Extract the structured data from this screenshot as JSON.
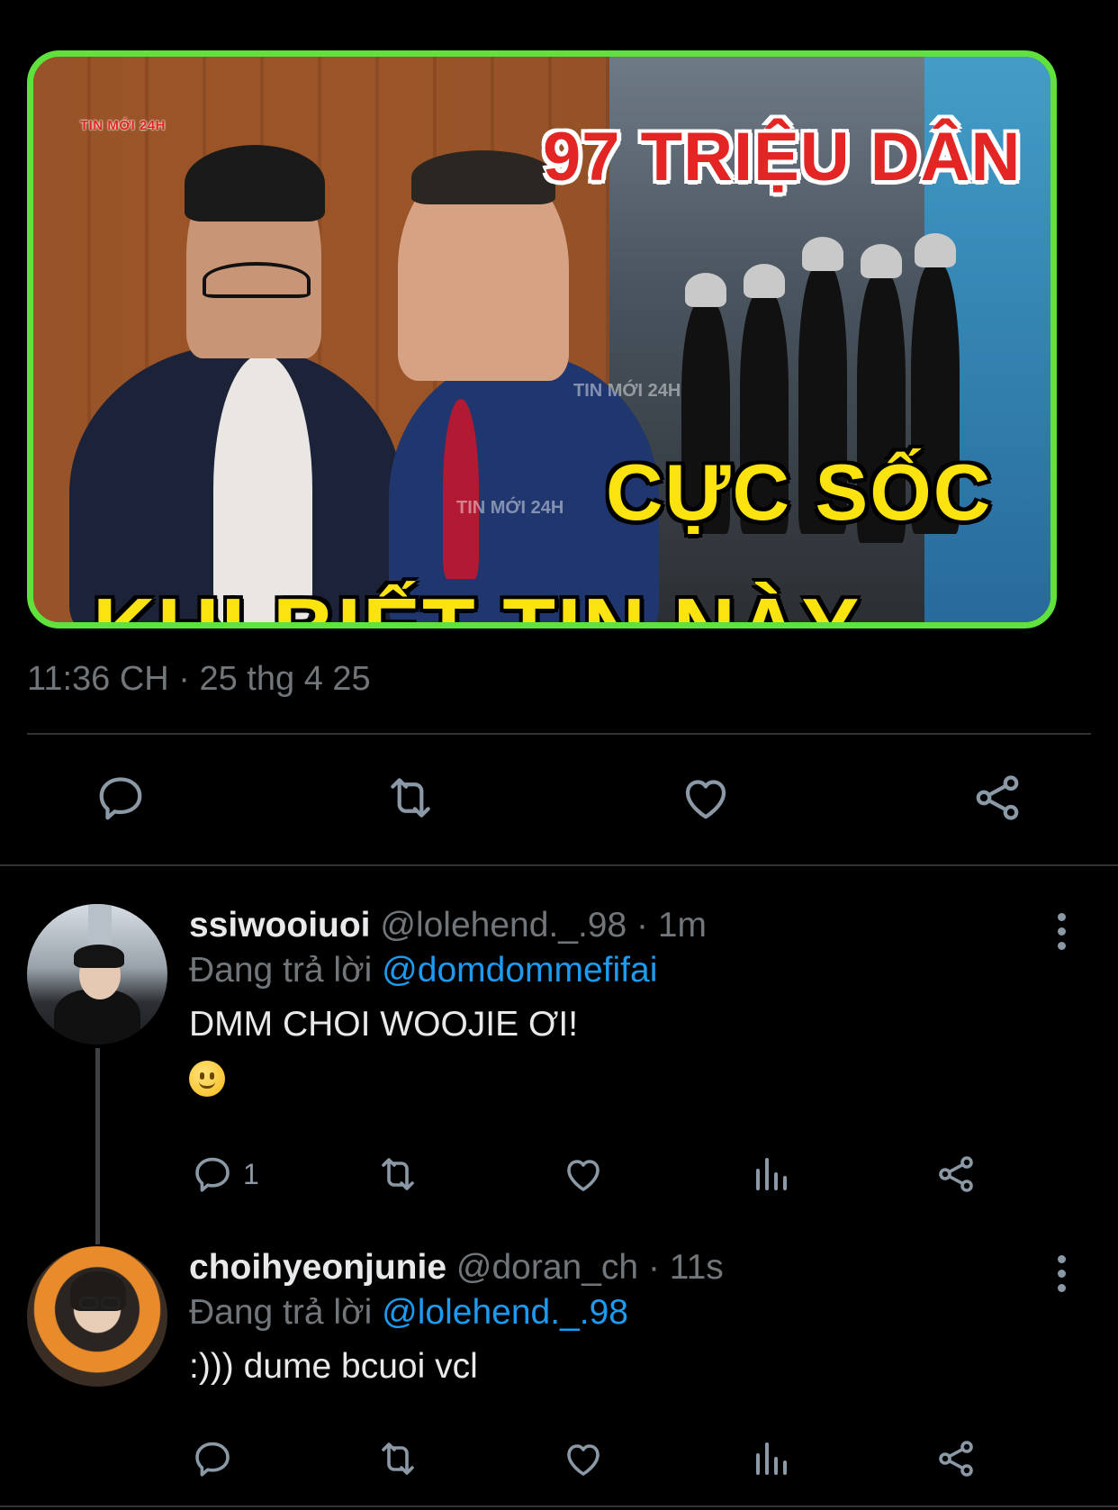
{
  "media": {
    "badge": "TIN MỚI 24H",
    "headline_top": "97 TRIỆU DÂN",
    "headline_mid": "CỰC SỐC",
    "headline_bottom": "KHI BIẾT TIN NÀY",
    "watermark_1": "TIN MỚI 24H",
    "watermark_2": "TIN MỚI 24H"
  },
  "tweet": {
    "timestamp": "11:36 CH · 25 thg 4 25"
  },
  "main_actions": {
    "icons": [
      "reply-icon",
      "retweet-icon",
      "like-icon",
      "share-icon"
    ]
  },
  "replies": [
    {
      "name": "ssiwooiuoi",
      "handle": "@lolehend._.98",
      "dot": "·",
      "time": "1m",
      "replying_prefix": "Đang trả lời",
      "replying_to": "@domdommefifai",
      "text": "DMM CHOI WOOJIE ƠI!",
      "emoji": "🙂",
      "reply_count": "1"
    },
    {
      "name": "choihyeonjunie",
      "handle": "@doran_ch",
      "dot": "·",
      "time": "11s",
      "replying_prefix": "Đang trả lời",
      "replying_to": "@lolehend._.98",
      "text": ":))) dume bcuoi vcl"
    }
  ],
  "colors": {
    "background": "#000000",
    "muted": "#71767b",
    "link": "#1d9bf0",
    "media_border": "#5fe23c"
  }
}
